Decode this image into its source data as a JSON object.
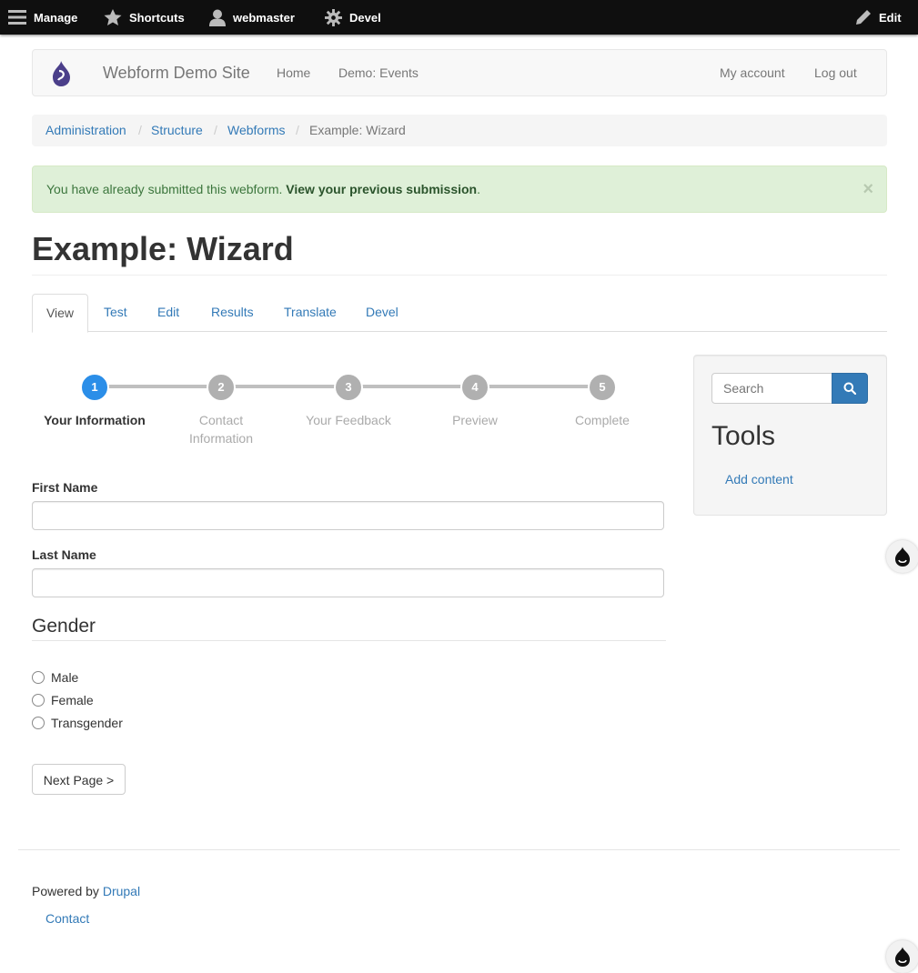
{
  "toolbar": {
    "manage": "Manage",
    "shortcuts": "Shortcuts",
    "user": "webmaster",
    "devel": "Devel",
    "edit": "Edit"
  },
  "navbar": {
    "brand": "Webform Demo Site",
    "home": "Home",
    "events": "Demo: Events",
    "account": "My account",
    "logout": "Log out"
  },
  "breadcrumb": [
    "Administration",
    "Structure",
    "Webforms",
    "Example: Wizard"
  ],
  "alert": {
    "text": "You have already submitted this webform.",
    "link": "View your previous submission",
    "suffix": ".",
    "close": "×"
  },
  "page_title": "Example: Wizard",
  "tabs": [
    "View",
    "Test",
    "Edit",
    "Results",
    "Translate",
    "Devel"
  ],
  "progress": {
    "current_step": 1,
    "steps": [
      {
        "num": "1",
        "label": "Your Information"
      },
      {
        "num": "2",
        "label": "Contact Information"
      },
      {
        "num": "3",
        "label": "Your Feedback"
      },
      {
        "num": "4",
        "label": "Preview"
      },
      {
        "num": "5",
        "label": "Complete"
      }
    ]
  },
  "form": {
    "first_name_label": "First Name",
    "first_name_value": "",
    "last_name_label": "Last Name",
    "last_name_value": "",
    "gender_legend": "Gender",
    "gender_options": [
      "Male",
      "Female",
      "Transgender"
    ],
    "next_button": "Next Page >"
  },
  "sidebar": {
    "search_placeholder": "Search",
    "tools_title": "Tools",
    "add_content": "Add content"
  },
  "footer": {
    "powered_prefix": "Powered by ",
    "powered_link": "Drupal",
    "contact": "Contact"
  },
  "colors": {
    "accent": "#337ab7",
    "step_active": "#2b8ee8",
    "alert_bg": "#dff0d8"
  }
}
